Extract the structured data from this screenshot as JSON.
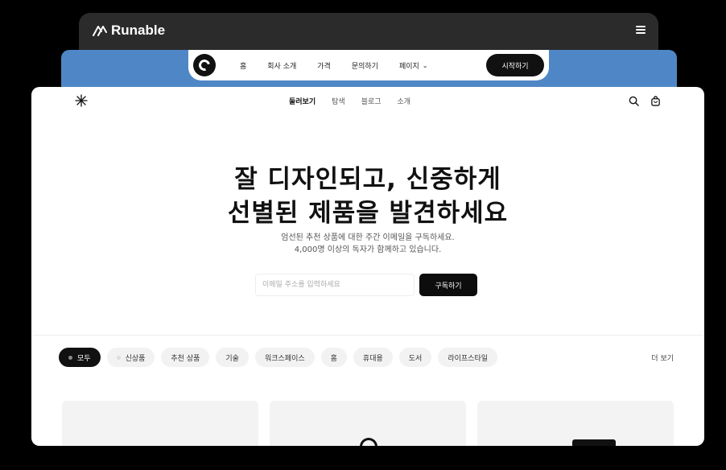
{
  "back_window": {
    "brand": "Runable",
    "icons": {
      "logo": "runable-logo-icon",
      "menu": "hamburger-icon"
    }
  },
  "mid_window": {
    "nav_items": [
      "홈",
      "회사 소개",
      "가격",
      "문의하기",
      "페이지"
    ],
    "cta_label": "시작하기",
    "icons": {
      "logo": "circle-logo-icon",
      "dropdown": "chevron-down-icon"
    }
  },
  "page": {
    "nav_items": [
      "둘러보기",
      "탐색",
      "블로그",
      "소개"
    ],
    "icons": {
      "logo": "sparkle-icon",
      "search": "search-icon",
      "cart": "bag-icon"
    },
    "hero": {
      "title_line1": "잘 디자인되고, 신중하게",
      "title_line2": "선별된 제품을 발견하세요",
      "subtitle_line1": "엄선된 추천 상품에 대한 주간 이메일을 구독하세요.",
      "subtitle_line2": "4,000명 이상의 독자가 함께하고 있습니다."
    },
    "signup": {
      "email_placeholder": "이메일 주소를 입력하세요",
      "subscribe_label": "구독하기"
    },
    "filters": [
      "모두",
      "신상품",
      "추천 상품",
      "기술",
      "워크스페이스",
      "홈",
      "휴대용",
      "도서",
      "라이프스타일"
    ],
    "more_label": "더 보기"
  },
  "colors": {
    "accent_blue": "#4f87c6",
    "dark": "#111111",
    "back_window": "#2b2b2b"
  }
}
